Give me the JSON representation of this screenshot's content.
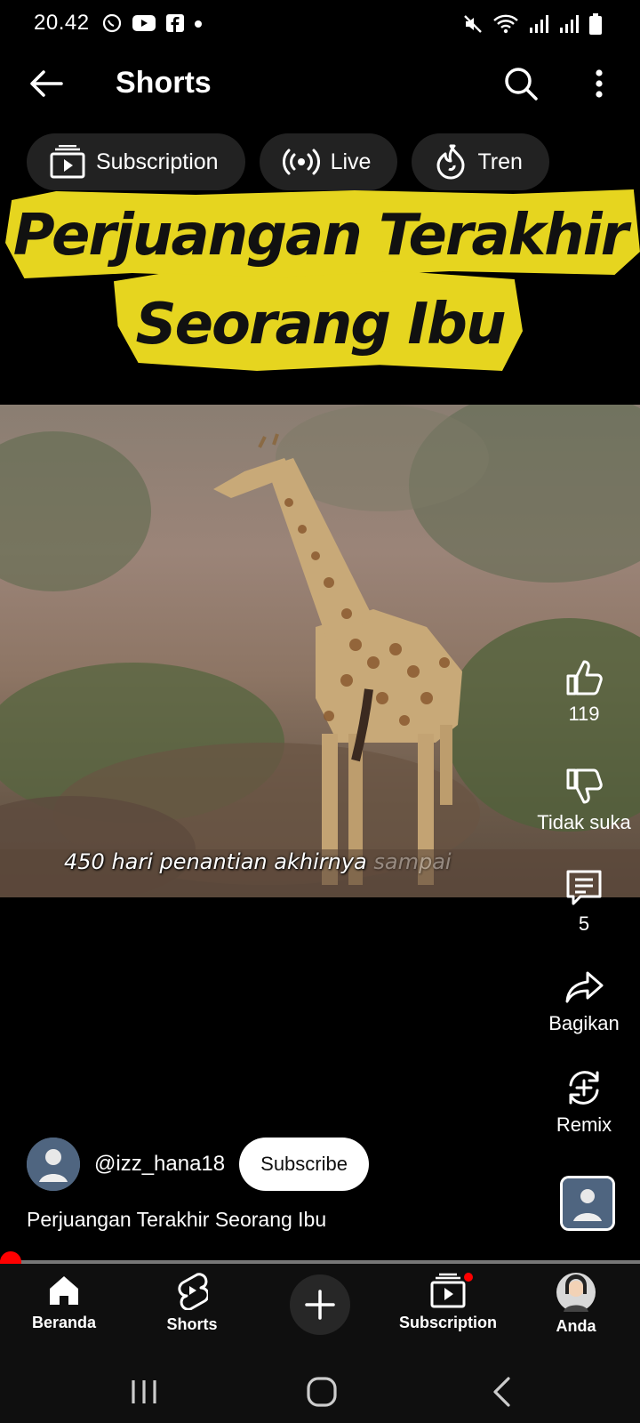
{
  "status_bar": {
    "time": "20.42",
    "left_icons": [
      "whatsapp-icon",
      "youtube-icon",
      "facebook-icon",
      "dot-icon"
    ],
    "right_icons": [
      "mute-icon",
      "wifi-icon",
      "signal-icon",
      "signal-icon",
      "battery-icon"
    ]
  },
  "header": {
    "title": "Shorts",
    "back_icon": "back-arrow-icon",
    "search_icon": "search-icon",
    "more_icon": "more-vertical-icon"
  },
  "chips": [
    {
      "label": "Subscription",
      "icon": "subscription-icon"
    },
    {
      "label": "Live",
      "icon": "live-icon"
    },
    {
      "label": "Tren",
      "icon": "trending-icon"
    }
  ],
  "video": {
    "overlay_title_line1": "Perjuangan Terakhir",
    "overlay_title_line2": "Seorang Ibu",
    "caption": "450 hari penantian akhirnya",
    "caption_faded": "sampai"
  },
  "actions": {
    "like_count": "119",
    "dislike_label": "Tidak suka",
    "comment_count": "5",
    "share_label": "Bagikan",
    "remix_label": "Remix"
  },
  "channel": {
    "handle": "@izz_hana18",
    "subscribe_label": "Subscribe"
  },
  "title": "Perjuangan Terakhir Seorang Ibu",
  "progress": {
    "fraction": 0.01
  },
  "bottom_nav": [
    {
      "label": "Beranda",
      "icon": "home-icon"
    },
    {
      "label": "Shorts",
      "icon": "shorts-icon"
    },
    {
      "label": "",
      "icon": "plus-icon"
    },
    {
      "label": "Subscription",
      "icon": "subscription-icon"
    },
    {
      "label": "Anda",
      "icon": "profile-avatar"
    }
  ],
  "colors": {
    "accent": "#ff0000",
    "banner_yellow": "#e6d51f",
    "background": "#000000"
  }
}
